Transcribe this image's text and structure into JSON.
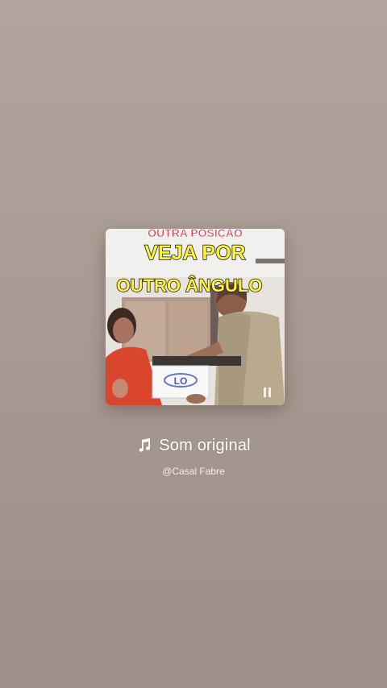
{
  "cover": {
    "top_caption": "OUTRA POSIÇÃO",
    "line1": "VEJA POR",
    "line2": "OUTRO ÂNGULO",
    "paper_text": "LO"
  },
  "track": {
    "title": "Som original",
    "artist": "@Casal Fabre"
  },
  "icons": {
    "music": "music-note-icon",
    "pause": "pause-icon"
  },
  "colors": {
    "caption_red": "#e8364f",
    "title_yellow": "#fff23a",
    "text_white": "#ffffff"
  }
}
